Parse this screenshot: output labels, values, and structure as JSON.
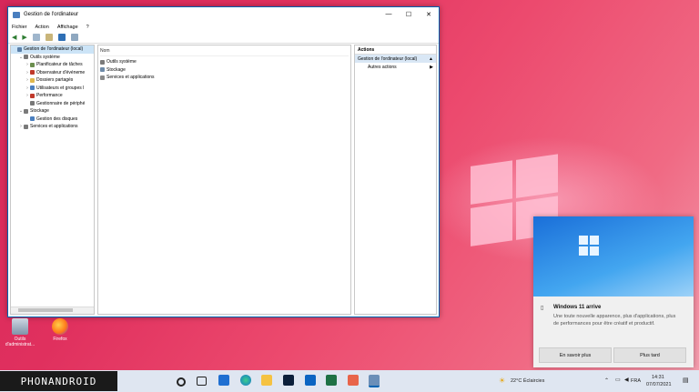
{
  "window": {
    "title": "Gestion de l'ordinateur",
    "minimize": "—",
    "maximize": "☐",
    "close": "✕"
  },
  "menu": [
    "Fichier",
    "Action",
    "Affichage",
    "?"
  ],
  "tree": [
    {
      "label": "Gestion de l'ordinateur (local)",
      "expander": "",
      "indent": 0,
      "selected": true,
      "color": "#5b7fa8"
    },
    {
      "label": "Outils système",
      "expander": "⌄",
      "indent": 1,
      "color": "#7a7a7a"
    },
    {
      "label": "Planificateur de tâches",
      "expander": "›",
      "indent": 2,
      "color": "#6b8e4e"
    },
    {
      "label": "Observateur d'événeme",
      "expander": "›",
      "indent": 2,
      "color": "#c0392b"
    },
    {
      "label": "Dossiers partagés",
      "expander": "›",
      "indent": 2,
      "color": "#e0b84e"
    },
    {
      "label": "Utilisateurs et groupes l",
      "expander": "›",
      "indent": 2,
      "color": "#4a7fbf"
    },
    {
      "label": "Performance",
      "expander": "›",
      "indent": 2,
      "color": "#c0392b"
    },
    {
      "label": "Gestionnaire de périphé",
      "expander": "",
      "indent": 2,
      "color": "#777"
    },
    {
      "label": "Stockage",
      "expander": "⌄",
      "indent": 1,
      "color": "#7a7a7a"
    },
    {
      "label": "Gestion des disques",
      "expander": "",
      "indent": 2,
      "color": "#4a7fbf"
    },
    {
      "label": "Services et applications",
      "expander": "›",
      "indent": 1,
      "color": "#7a7a7a"
    }
  ],
  "center": {
    "header": "Nom",
    "items": [
      "Outils système",
      "Stockage",
      "Services et applications"
    ]
  },
  "actions": {
    "header": "Actions",
    "section": "Gestion de l'ordinateur (local)",
    "section_arrow": "▲",
    "more": "Autres actions",
    "more_arrow": "▶"
  },
  "desktop": [
    {
      "label": "Outils d'administrat...",
      "icon": "admin-tools-icon"
    },
    {
      "label": "Firefox",
      "icon": "firefox-icon"
    }
  ],
  "notification": {
    "title": "Windows 11 arrive",
    "body": "Une toute nouvelle apparence, plus d'applications, plus de performances pour être créatif et productif.",
    "btn_learn": "En savoir plus",
    "btn_later": "Plus tard"
  },
  "brand": "PHONANDROID",
  "tray": {
    "weather": "22°C  Éclaircies",
    "lang": "FRA",
    "time": "14:31",
    "date": "07/07/2021"
  },
  "colors": {
    "accent": "#0063b1",
    "wallpaper": "#e0305e"
  }
}
